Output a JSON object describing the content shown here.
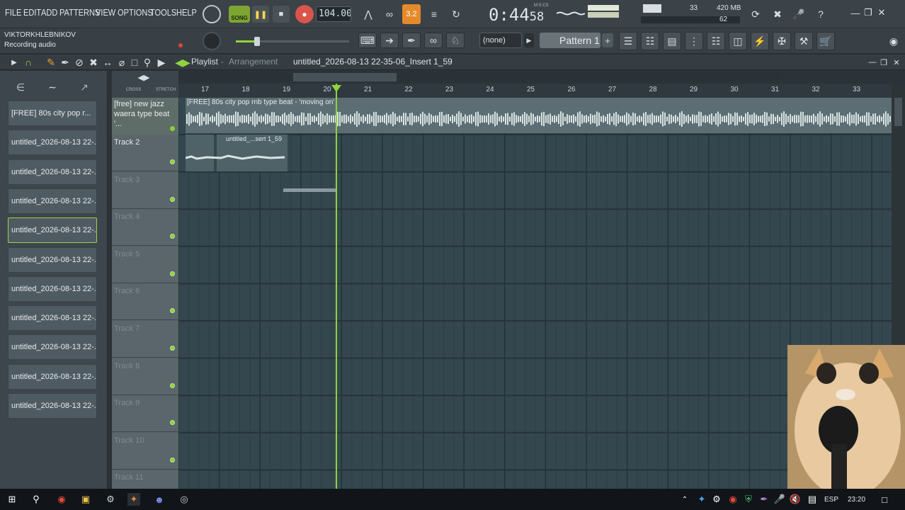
{
  "menu": {
    "file": "FILE",
    "edit": "EDIT",
    "add": "ADD",
    "patterns": "PATTERNS",
    "view": "VIEW",
    "options": "OPTIONS",
    "tools": "TOOLS",
    "help": "HELP"
  },
  "transport": {
    "song_label": "SONG",
    "tempo": "104.000",
    "time_main": "0:44",
    "time_sub": "58",
    "time_unit": "M:S:CS",
    "beat_indicator": "3.2"
  },
  "monitor": {
    "cpu": "33",
    "memory": "420 MB",
    "polyphony": "62"
  },
  "hint": {
    "username": "VIKTORKHLEBNIKOV",
    "status": "Recording audio"
  },
  "pattern": {
    "channel_select": "(none)",
    "name": "Pattern 1"
  },
  "playlist": {
    "title": "Playlist",
    "separator": "-",
    "view": "Arrangement",
    "file": "untitled_2026-08-13 22-35-06_Insert 1_59",
    "ruler": [
      "17",
      "18",
      "19",
      "20",
      "21",
      "22",
      "23",
      "24",
      "25",
      "26",
      "27",
      "28",
      "29",
      "30",
      "31",
      "32",
      "33"
    ],
    "ruler_small_left": "CROSS",
    "ruler_small_right": "STRETCH"
  },
  "picker": {
    "clips": [
      "[FREE] 80s city pop  r...",
      "untitled_2026-08-13 22-...",
      "untitled_2026-08-13 22-...",
      "untitled_2026-08-13 22-...",
      "untitled_2026-08-13 22-...",
      "untitled_2026-08-13 22-...",
      "untitled_2026-08-13 22-...",
      "untitled_2026-08-13 22-...",
      "untitled_2026-08-13 22-...",
      "untitled_2026-08-13 22-...",
      "untitled_2026-08-13 22-..."
    ]
  },
  "tracks": {
    "track1_line1": "[free] new jazz",
    "track1_line2": "waera type beat '...",
    "names": [
      "Track 2",
      "Track 3",
      "Track 4",
      "Track 5",
      "Track 6",
      "Track 7",
      "Track 8",
      "Track 9",
      "Track 10",
      "Track 11"
    ],
    "audio_clip_label": "[FREE] 80s city pop  rnb type beat - 'moving on'",
    "track2_clip_label": "untitled_...sert 1_59"
  },
  "taskbar": {
    "language": "ESP",
    "time": "23:20"
  },
  "colors": {
    "accent_green": "#8fd43c",
    "record_red": "#d9544a",
    "grid_bg": "#34474f"
  }
}
